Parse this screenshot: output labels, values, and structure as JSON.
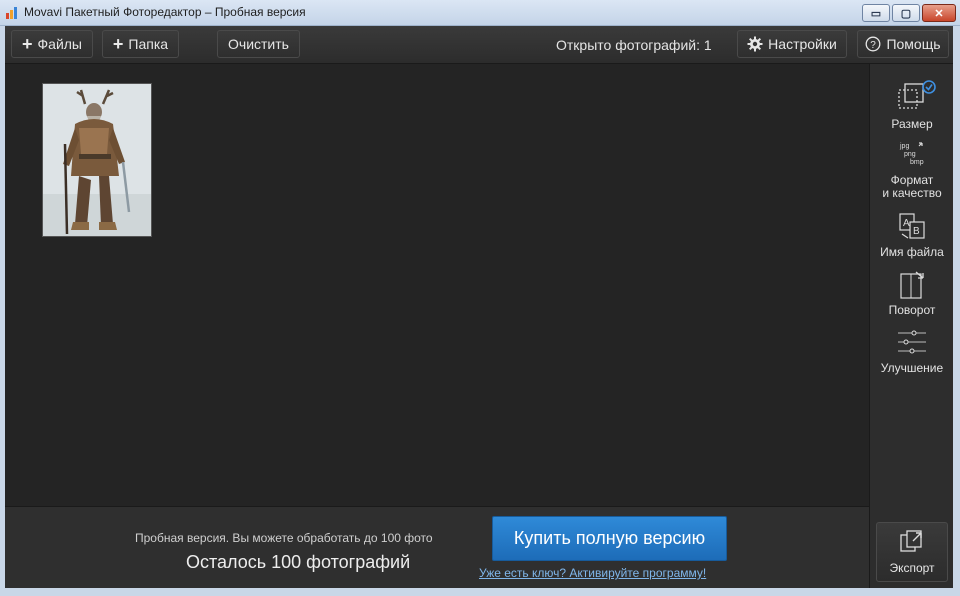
{
  "window": {
    "title": "Movavi Пакетный Фоторедактор – Пробная версия",
    "controls": {
      "minimize": "▭",
      "maximize": "▢",
      "close": "✕"
    }
  },
  "toolbar": {
    "files_label": "Файлы",
    "folder_label": "Папка",
    "clear_label": "Очистить",
    "photo_count": "Открыто фотографий: 1",
    "settings_label": "Настройки",
    "help_label": "Помощь"
  },
  "sidebar": {
    "size_label": "Размер",
    "format_line1": "Формат",
    "format_line2": "и качество",
    "format_icon_text": [
      "jpg",
      "png",
      "bmp"
    ],
    "filename_label": "Имя файла",
    "filename_icon_text": [
      "A",
      "B"
    ],
    "rotate_label": "Поворот",
    "enhance_label": "Улучшение",
    "export_label": "Экспорт"
  },
  "bottom": {
    "trial_text": "Пробная версия. Вы можете обработать до 100 фото",
    "remaining": "Осталось 100 фотографий",
    "buy_label": "Купить полную версию",
    "activate_link": "Уже есть ключ? Активируйте программу!"
  },
  "photos": [
    {
      "thumbnail": "horned-warrior-illustration"
    }
  ],
  "colors": {
    "accent": "#1f74c3",
    "link": "#7fb6ea",
    "background": "#242424"
  }
}
